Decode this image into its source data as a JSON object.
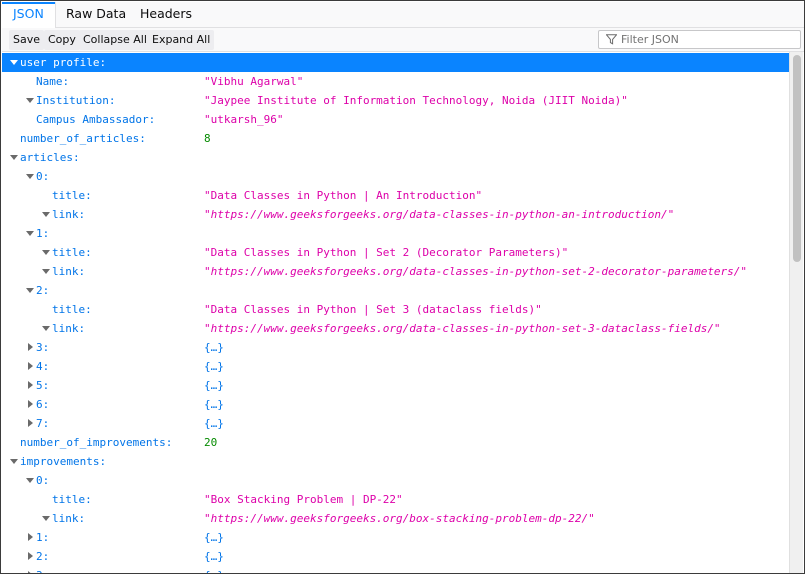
{
  "tabs": [
    {
      "label": "JSON",
      "active": true
    },
    {
      "label": "Raw Data",
      "active": false
    },
    {
      "label": "Headers",
      "active": false
    }
  ],
  "toolbar": {
    "save": "Save",
    "copy": "Copy",
    "collapse_all": "Collapse All",
    "expand_all": "Expand All",
    "filter_placeholder": "Filter JSON"
  },
  "colors": {
    "accent": "#0a84ff",
    "key": "#0074e8",
    "string": "#dd00a9",
    "number": "#058b00"
  },
  "rows": [
    {
      "key": "user profile:",
      "value": "",
      "type": "section",
      "indent": 0,
      "toggle": "open",
      "selected": true
    },
    {
      "key": "Name:",
      "value": "\"Vibhu Agarwal\"",
      "type": "str",
      "indent": 1,
      "toggle": "none"
    },
    {
      "key": "Institution:",
      "value": "\"Jaypee Institute of Information Technology, Noida (JIIT Noida)\"",
      "type": "str",
      "indent": 1,
      "toggle": "open"
    },
    {
      "key": "Campus Ambassador:",
      "value": "\"utkarsh_96\"",
      "type": "str",
      "indent": 1,
      "toggle": "none"
    },
    {
      "key": "number_of_articles:",
      "value": "8",
      "type": "num",
      "indent": 0,
      "toggle": "none"
    },
    {
      "key": "articles:",
      "value": "",
      "type": "section",
      "indent": 0,
      "toggle": "open"
    },
    {
      "key": "0:",
      "value": "",
      "type": "section",
      "indent": 1,
      "toggle": "open"
    },
    {
      "key": "title:",
      "value": "\"Data Classes in Python | An Introduction\"",
      "type": "str",
      "indent": 2,
      "toggle": "none"
    },
    {
      "key": "link:",
      "value": "\"https://www.geeksforgeeks.org/data-classes-in-python-an-introduction/\"",
      "type": "url",
      "indent": 2,
      "toggle": "open"
    },
    {
      "key": "1:",
      "value": "",
      "type": "section",
      "indent": 1,
      "toggle": "open"
    },
    {
      "key": "title:",
      "value": "\"Data Classes in Python | Set 2 (Decorator Parameters)\"",
      "type": "str",
      "indent": 2,
      "toggle": "open"
    },
    {
      "key": "link:",
      "value": "\"https://www.geeksforgeeks.org/data-classes-in-python-set-2-decorator-parameters/\"",
      "type": "url",
      "indent": 2,
      "toggle": "open"
    },
    {
      "key": "2:",
      "value": "",
      "type": "section",
      "indent": 1,
      "toggle": "open"
    },
    {
      "key": "title:",
      "value": "\"Data Classes in Python | Set 3 (dataclass fields)\"",
      "type": "str",
      "indent": 2,
      "toggle": "none"
    },
    {
      "key": "link:",
      "value": "\"https://www.geeksforgeeks.org/data-classes-in-python-set-3-dataclass-fields/\"",
      "type": "url",
      "indent": 2,
      "toggle": "open"
    },
    {
      "key": "3:",
      "value": "{…}",
      "type": "obj",
      "indent": 1,
      "toggle": "closed"
    },
    {
      "key": "4:",
      "value": "{…}",
      "type": "obj",
      "indent": 1,
      "toggle": "closed"
    },
    {
      "key": "5:",
      "value": "{…}",
      "type": "obj",
      "indent": 1,
      "toggle": "closed"
    },
    {
      "key": "6:",
      "value": "{…}",
      "type": "obj",
      "indent": 1,
      "toggle": "closed"
    },
    {
      "key": "7:",
      "value": "{…}",
      "type": "obj",
      "indent": 1,
      "toggle": "closed"
    },
    {
      "key": "number_of_improvements:",
      "value": "20",
      "type": "num",
      "indent": 0,
      "toggle": "none"
    },
    {
      "key": "improvements:",
      "value": "",
      "type": "section",
      "indent": 0,
      "toggle": "open"
    },
    {
      "key": "0:",
      "value": "",
      "type": "section",
      "indent": 1,
      "toggle": "open"
    },
    {
      "key": "title:",
      "value": "\"Box Stacking Problem | DP-22\"",
      "type": "str",
      "indent": 2,
      "toggle": "none"
    },
    {
      "key": "link:",
      "value": "\"https://www.geeksforgeeks.org/box-stacking-problem-dp-22/\"",
      "type": "url",
      "indent": 2,
      "toggle": "open"
    },
    {
      "key": "1:",
      "value": "{…}",
      "type": "obj",
      "indent": 1,
      "toggle": "closed"
    },
    {
      "key": "2:",
      "value": "{…}",
      "type": "obj",
      "indent": 1,
      "toggle": "closed"
    },
    {
      "key": "3:",
      "value": "{…}",
      "type": "obj",
      "indent": 1,
      "toggle": "closed"
    }
  ]
}
